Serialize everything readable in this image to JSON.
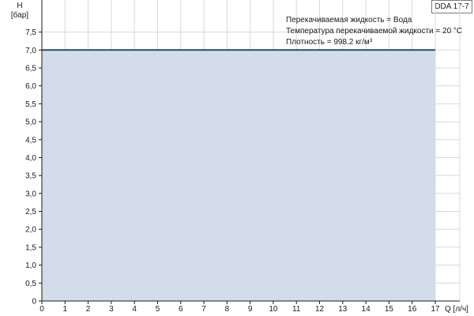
{
  "model": "DDA 17-7",
  "notes": [
    "Перекачиваемая жидкость = Вода",
    "Температура перекачиваемой жидкости = 20 °C",
    "Плотность = 998.2 кг/м³"
  ],
  "chart_data": {
    "type": "area",
    "title": "",
    "ylabel_line1": "H",
    "ylabel_line2": "[бар]",
    "xlabel": "Q [л/ч]",
    "xlim": [
      0,
      17
    ],
    "ylim": [
      0,
      7.5
    ],
    "grid": true,
    "x_ticks": [
      "0",
      "1",
      "2",
      "3",
      "4",
      "5",
      "6",
      "7",
      "8",
      "9",
      "10",
      "11",
      "12",
      "13",
      "14",
      "15",
      "16",
      "17"
    ],
    "y_ticks": [
      "0",
      "0,5",
      "1,0",
      "1,5",
      "2,0",
      "2,5",
      "3,0",
      "3,5",
      "4,0",
      "4,5",
      "5,0",
      "5,5",
      "6,0",
      "6,5",
      "7,0",
      "7,5"
    ],
    "series": [
      {
        "x": [
          0,
          17
        ],
        "y": [
          7.0,
          7.0
        ]
      }
    ],
    "colors": {
      "line": "#1f4e79",
      "fill": "#d3dde9",
      "grid": "#d9d9d9",
      "axis": "#1a1a1a"
    }
  }
}
